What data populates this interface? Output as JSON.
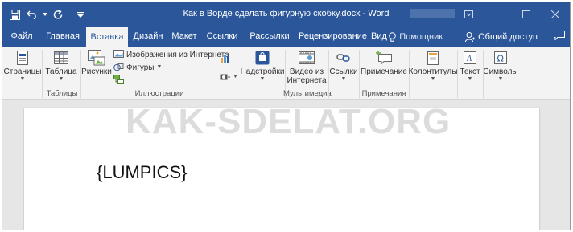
{
  "window": {
    "title": "Как в Ворде сделать фигурную скобку.docx - Word",
    "controls": [
      "restore-icon",
      "minimize-icon",
      "maximize-icon",
      "close-icon"
    ]
  },
  "qat": [
    "save-icon",
    "undo-icon",
    "redo-icon",
    "customize-icon"
  ],
  "tabs": [
    {
      "label": "Файл"
    },
    {
      "label": "Главная"
    },
    {
      "label": "Вставка",
      "active": true
    },
    {
      "label": "Дизайн"
    },
    {
      "label": "Макет"
    },
    {
      "label": "Ссылки"
    },
    {
      "label": "Рассылки"
    },
    {
      "label": "Рецензирование"
    },
    {
      "label": "Вид"
    }
  ],
  "tell_me": "Помощник",
  "share": "Общий доступ",
  "ribbon": {
    "pages": "Страницы",
    "table": "Таблица",
    "pictures": "Рисунки",
    "online_images": "Изображения из Интернета",
    "shapes": "Фигуры",
    "addins": "Надстройки",
    "online_video": "Видео из Интернета",
    "links": "Ссылки",
    "comment": "Примечание",
    "header_footer": "Колонтитулы",
    "text": "Текст",
    "symbols": "Символы"
  },
  "groups": {
    "tables": "Таблицы",
    "illustrations": "Иллюстрации",
    "media": "Мультимедиа",
    "comments": "Примечания"
  },
  "document": {
    "content": "{LUMPICS}"
  },
  "watermark": "KAK-SDELAT.ORG",
  "colors": {
    "accent": "#2b579a",
    "ribbon_bg": "#f3f3f3",
    "doc_bg": "#e6e6e6"
  }
}
